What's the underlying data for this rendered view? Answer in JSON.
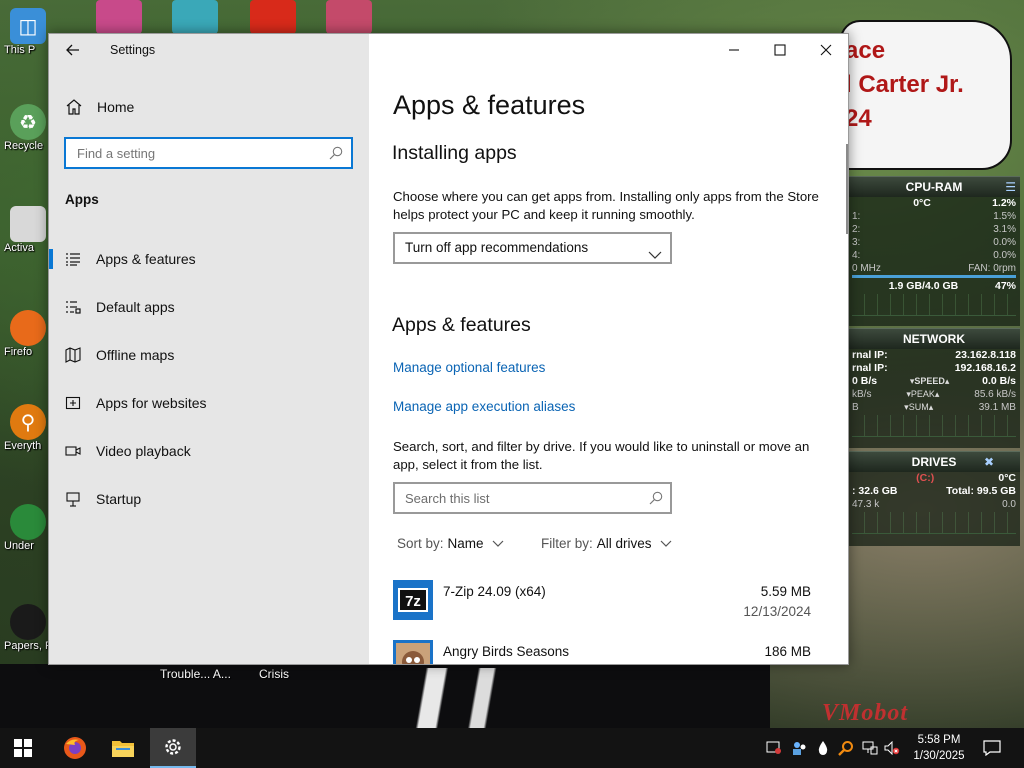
{
  "desktop": {
    "icons": [
      {
        "label": "This P"
      },
      {
        "label": "Recycle"
      },
      {
        "label": "Activa"
      },
      {
        "label": "Firefo"
      },
      {
        "label": "Everyth"
      },
      {
        "label": "Under"
      },
      {
        "label": "Papers, P"
      }
    ],
    "below_window_labels": [
      "Trouble... A...",
      "Crisis"
    ],
    "speech_lines": [
      "ace",
      "l Carter Jr.",
      "24"
    ],
    "watermark": "VMobot"
  },
  "gadgets": {
    "cpu_ram": {
      "title": "CPU-RAM",
      "temp": "0°C",
      "total_pct": "1.2%",
      "cores": [
        {
          "label": "1:",
          "value": "1.5%"
        },
        {
          "label": "2:",
          "value": "3.1%"
        },
        {
          "label": "3:",
          "value": "0.0%"
        },
        {
          "label": "4:",
          "value": "0.0%"
        }
      ],
      "freq": "0 MHz",
      "fan": "FAN: 0rpm",
      "ram": "1.9 GB/4.0 GB",
      "ram_pct": "47%"
    },
    "network": {
      "title": "NETWORK",
      "external_label": "rnal IP:",
      "external_ip": "23.162.8.118",
      "internal_label": "rnal IP:",
      "internal_ip": "192.168.16.2",
      "speed_left": "0 B/s",
      "speed_label": "SPEED",
      "speed_right": "0.0 B/s",
      "peak_left": "kB/s",
      "peak_label": "PEAK",
      "peak_right": "85.6 kB/s",
      "sum_left": "B",
      "sum_label": "SUM",
      "sum_right": "39.1 MB"
    },
    "drives": {
      "title": "DRIVES",
      "drive": "(C:)",
      "temp": "0°C",
      "free": ": 32.6 GB",
      "total": "Total: 99.5 GB",
      "io_left": "47.3 k",
      "io_right": "0.0"
    }
  },
  "window": {
    "title": "Settings",
    "sidebar": {
      "home": "Home",
      "search_placeholder": "Find a setting",
      "section": "Apps",
      "items": [
        {
          "label": "Apps & features",
          "icon": "list-icon",
          "selected": true
        },
        {
          "label": "Default apps",
          "icon": "default-apps-icon",
          "selected": false
        },
        {
          "label": "Offline maps",
          "icon": "map-icon",
          "selected": false
        },
        {
          "label": "Apps for websites",
          "icon": "web-apps-icon",
          "selected": false
        },
        {
          "label": "Video playback",
          "icon": "video-icon",
          "selected": false
        },
        {
          "label": "Startup",
          "icon": "startup-icon",
          "selected": false
        }
      ]
    },
    "content": {
      "page_title": "Apps & features",
      "installing_heading": "Installing apps",
      "installing_desc": "Choose where you can get apps from. Installing only apps from the Store helps protect your PC and keep it running smoothly.",
      "install_dropdown_value": "Turn off app recommendations",
      "features_heading": "Apps & features",
      "link_optional": "Manage optional features",
      "link_aliases": "Manage app execution aliases",
      "search_desc": "Search, sort, and filter by drive. If you would like to uninstall or move an app, select it from the list.",
      "search_placeholder": "Search this list",
      "sort_label": "Sort by:",
      "sort_value": "Name",
      "filter_label": "Filter by:",
      "filter_value": "All drives",
      "apps": [
        {
          "name": "7-Zip 24.09 (x64)",
          "size": "5.59 MB",
          "date": "12/13/2024"
        },
        {
          "name": "Angry Birds Seasons",
          "size": "186 MB",
          "date": ""
        }
      ]
    }
  },
  "taskbar": {
    "time": "5:58 PM",
    "date": "1/30/2025"
  },
  "colors": {
    "accent": "#0a78d4",
    "link": "#0a64b4",
    "sidebar_bg": "#e6e6e6",
    "taskbar_bg": "#131313"
  }
}
